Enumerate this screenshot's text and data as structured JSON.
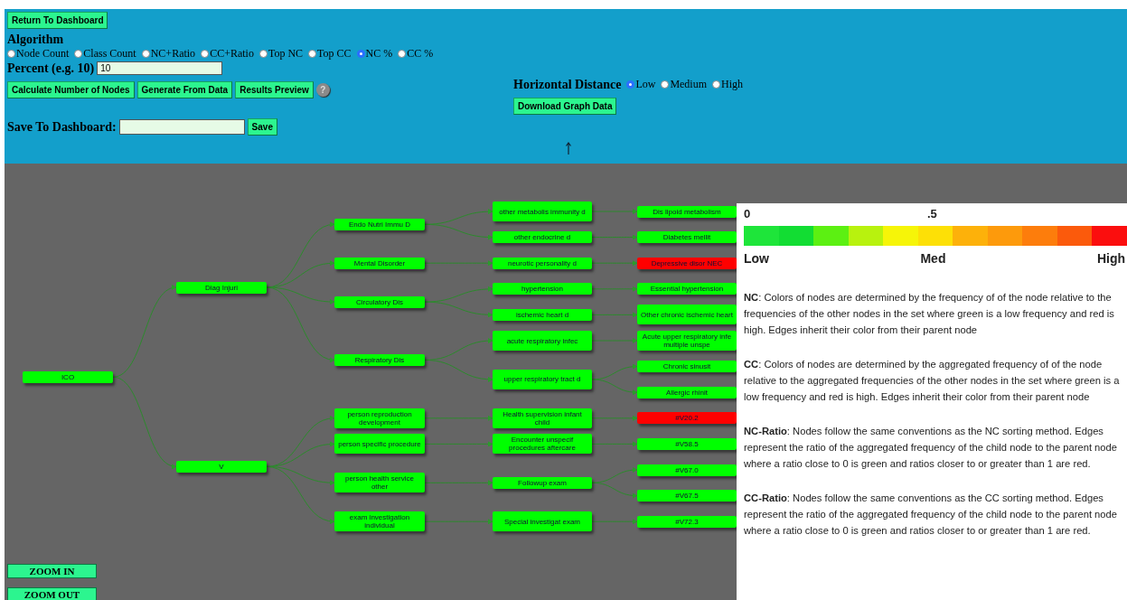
{
  "header": {
    "return_button": "Return To Dashboard",
    "algorithm_label": "Algorithm",
    "algorithms": [
      {
        "label": "Node Count",
        "selected": false
      },
      {
        "label": "Class Count",
        "selected": false
      },
      {
        "label": "NC+Ratio",
        "selected": false
      },
      {
        "label": "CC+Ratio",
        "selected": false
      },
      {
        "label": "Top NC",
        "selected": false
      },
      {
        "label": "Top CC",
        "selected": false
      },
      {
        "label": "NC %",
        "selected": true
      },
      {
        "label": "CC %",
        "selected": false
      }
    ],
    "percent_label": "Percent (e.g. 10)",
    "percent_value": "10",
    "actions": [
      "Calculate Number of Nodes",
      "Generate From Data",
      "Results Preview"
    ],
    "help": "?",
    "save_label": "Save To Dashboard:",
    "save_button": "Save",
    "distance_label": "Horizontal Distance",
    "distances": [
      {
        "label": "Low",
        "selected": true
      },
      {
        "label": "Medium",
        "selected": false
      },
      {
        "label": "High",
        "selected": false
      }
    ],
    "download_button": "Download Graph Data"
  },
  "graph": {
    "root": {
      "label": "ICO",
      "color": "#00ff00",
      "children": [
        {
          "label": "Diag Injuri",
          "color": "#00ff00",
          "children": [
            {
              "label": "Endo Nutri Immu D",
              "color": "#00ff00",
              "children": [
                {
                  "label": "other metabolis immunity d",
                  "color": "#00ff00",
                  "children": [
                    {
                      "label": "Dis lipoid metabolism",
                      "color": "#00ff00"
                    }
                  ]
                },
                {
                  "label": "other endocrine d",
                  "color": "#00ff00",
                  "children": [
                    {
                      "label": "Diabetes mellit",
                      "color": "#00ff00"
                    }
                  ]
                }
              ]
            },
            {
              "label": "Mental Disorder",
              "color": "#00ff00",
              "children": [
                {
                  "label": "neurotic personality d",
                  "color": "#00ff00",
                  "children": [
                    {
                      "label": "Depressive disor NEC",
                      "color": "#ff0000"
                    }
                  ]
                }
              ]
            },
            {
              "label": "Circulatory Dis",
              "color": "#00ff00",
              "children": [
                {
                  "label": "hypertension",
                  "color": "#00ff00",
                  "children": [
                    {
                      "label": "Essential hypertension",
                      "color": "#00ff00"
                    }
                  ]
                },
                {
                  "label": "ischemic heart d",
                  "color": "#00ff00",
                  "children": [
                    {
                      "label": "Other chronic ischemic heart",
                      "color": "#00ff00"
                    }
                  ]
                }
              ]
            },
            {
              "label": "Respiratory Dis",
              "color": "#00ff00",
              "children": [
                {
                  "label": "acute respiratory infec",
                  "color": "#00ff00",
                  "children": [
                    {
                      "label": "Acute upper respiratory infe multiple unspe",
                      "color": "#00ff00"
                    }
                  ]
                },
                {
                  "label": "upper respiratory tract d",
                  "color": "#00ff00",
                  "children": [
                    {
                      "label": "Chronic sinusit",
                      "color": "#00ff00"
                    },
                    {
                      "label": "Allergic rhinit",
                      "color": "#00ff00"
                    }
                  ]
                }
              ]
            }
          ]
        },
        {
          "label": "V",
          "color": "#00ff00",
          "children": [
            {
              "label": "person reproduction development",
              "color": "#00ff00",
              "children": [
                {
                  "label": "Health supervision infant child",
                  "color": "#00ff00",
                  "children": [
                    {
                      "label": "#V20.2",
                      "color": "#ff0000"
                    }
                  ]
                }
              ]
            },
            {
              "label": "person specific procedure",
              "color": "#00ff00",
              "children": [
                {
                  "label": "Encounter unspecif procedures aftercare",
                  "color": "#00ff00",
                  "children": [
                    {
                      "label": "#V58.5",
                      "color": "#00ff00"
                    }
                  ]
                }
              ]
            },
            {
              "label": "person health service other",
              "color": "#00ff00",
              "children": [
                {
                  "label": "Followup exam",
                  "color": "#00ff00",
                  "children": [
                    {
                      "label": "#V67.0",
                      "color": "#00ff00"
                    },
                    {
                      "label": "#V67.5",
                      "color": "#00ff00"
                    }
                  ]
                }
              ]
            },
            {
              "label": "exam investigation individual",
              "color": "#00ff00",
              "children": [
                {
                  "label": "Special investigat exam",
                  "color": "#00ff00",
                  "children": [
                    {
                      "label": "#V72.3",
                      "color": "#00ff00"
                    }
                  ]
                }
              ]
            }
          ]
        }
      ]
    },
    "zoom_buttons": [
      "ZOOM IN",
      "ZOOM OUT"
    ]
  },
  "legend": {
    "scale_ticks": [
      "0",
      ".5"
    ],
    "scale_labels": [
      "Low",
      "Med",
      "High"
    ],
    "paragraphs": [
      "**NC**: Colors of nodes are determined by the frequency of of the node relative to the frequencies of the other nodes in the set where green is a low frequency and red is high. Edges inherit their color from their parent node",
      "**CC**: Colors of nodes are determined by the aggregated frequency of of the node relative to the aggregated frequencies of the other nodes in the set where green is a low frequency and red is high. Edges inherit their color from their parent node",
      "**NC-Ratio**: Nodes follow the same conventions as the NC sorting method. Edges represent the ratio of the aggregated frequency of the child node to the parent node where a ratio close to 0 is green and ratios closer to or greater than 1 are red.",
      "**CC-Ratio**: Nodes follow the same conventions as the CC sorting method. Edges represent the ratio of the aggregated frequency of the child node to the parent node where a ratio close to 0 is green and ratios closer to or greater than 1 are red."
    ]
  }
}
